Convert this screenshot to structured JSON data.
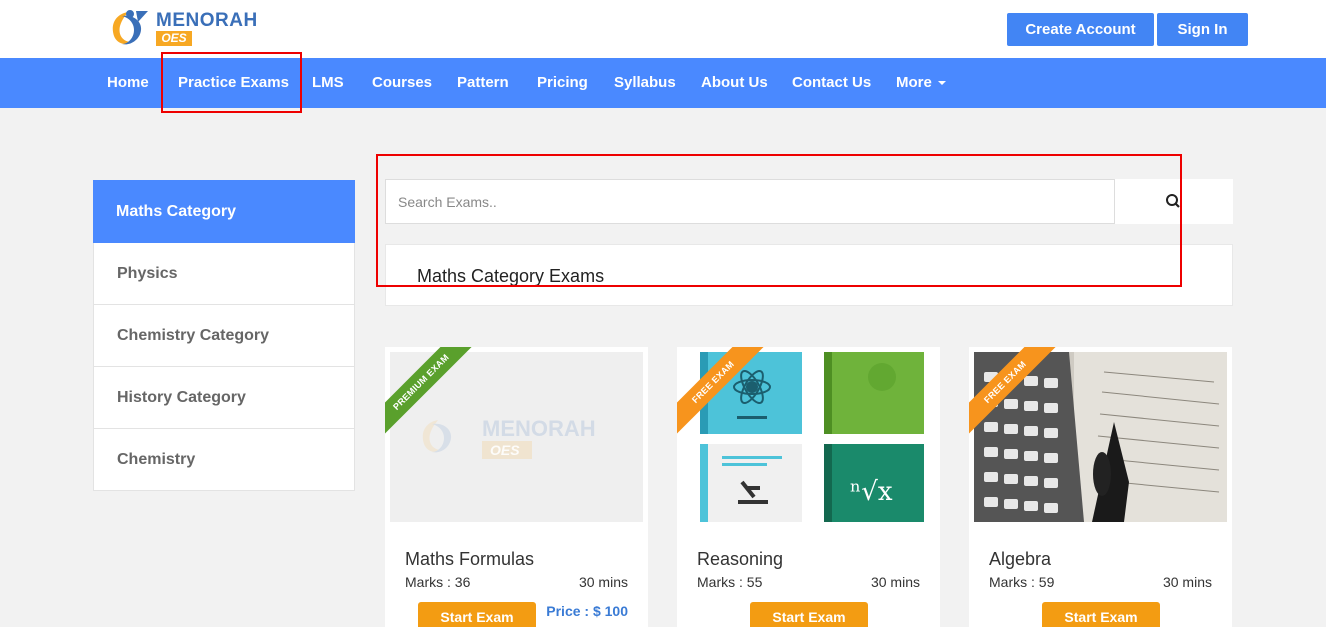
{
  "brand": {
    "name": "MENORAH",
    "sub": "OES"
  },
  "header": {
    "create_account": "Create Account",
    "sign_in": "Sign In"
  },
  "nav": {
    "home": "Home",
    "practice_exams": "Practice Exams",
    "lms": "LMS",
    "courses": "Courses",
    "pattern": "Pattern",
    "pricing": "Pricing",
    "syllabus": "Syllabus",
    "about_us": "About Us",
    "contact_us": "Contact Us",
    "more": "More"
  },
  "sidebar": {
    "items": [
      {
        "label": "Maths Category",
        "active": true
      },
      {
        "label": "Physics"
      },
      {
        "label": "Chemistry Category"
      },
      {
        "label": "History Category"
      },
      {
        "label": "Chemistry"
      }
    ]
  },
  "search": {
    "placeholder": "Search Exams.."
  },
  "category_heading": "Maths Category Exams",
  "cards": [
    {
      "ribbon": "PREMIUM EXAM",
      "title": "Maths Formulas",
      "marks": "Marks : 36",
      "duration": "30 mins",
      "price": "Price : $ 100",
      "button": "Start Exam"
    },
    {
      "ribbon": "FREE EXAM",
      "title": "Reasoning",
      "marks": "Marks : 55",
      "duration": "30 mins",
      "button": "Start Exam"
    },
    {
      "ribbon": "FREE EXAM",
      "title": "Algebra",
      "marks": "Marks : 59",
      "duration": "30 mins",
      "button": "Start Exam"
    }
  ],
  "colors": {
    "nav_blue": "#4a89ff",
    "button_blue": "#4285f4",
    "accent_orange": "#f39c12",
    "highlight_red": "#e00000"
  }
}
